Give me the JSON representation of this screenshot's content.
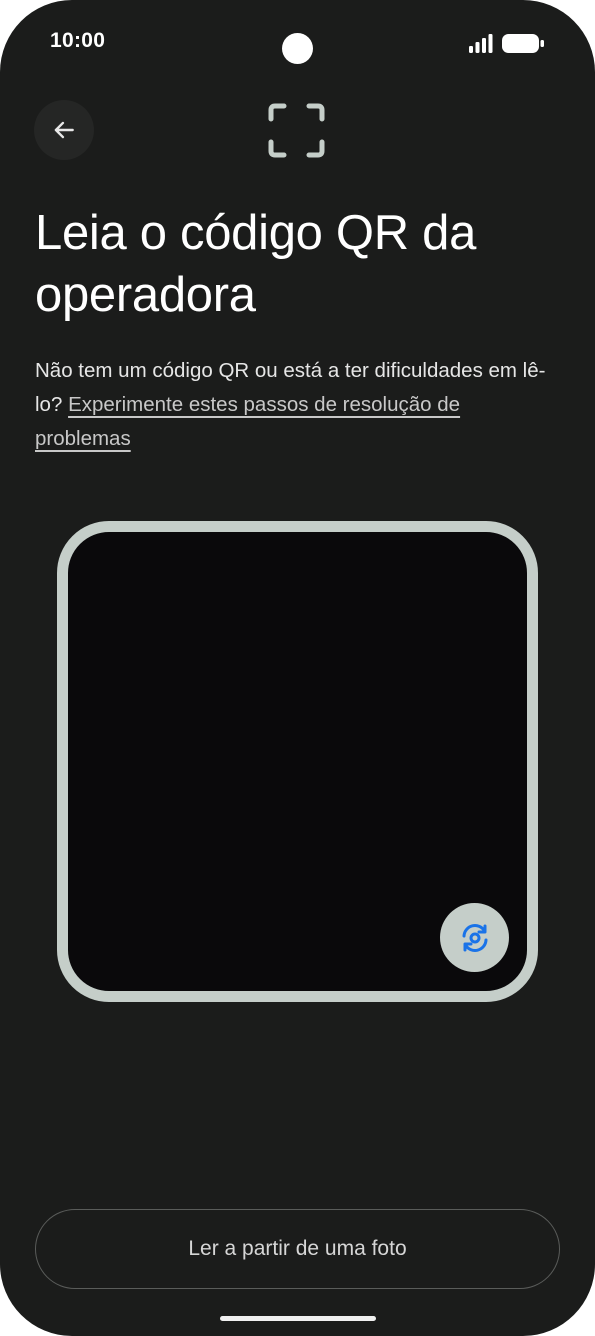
{
  "status_bar": {
    "time": "10:00",
    "icons": [
      "signal-icon",
      "battery-icon"
    ]
  },
  "header": {
    "back_icon": "arrow-back-icon",
    "scan_icon": "qr-scan-frame-icon"
  },
  "content": {
    "title": "Leia o código QR da operadora",
    "description_prefix": "Não tem um código QR ou está a ter dificuldades em lê-lo? ",
    "description_link": "Experimente estes passos de resolução de problemas"
  },
  "camera": {
    "flip_icon": "flip-camera-icon"
  },
  "footer": {
    "photo_button_label": "Ler a partir de uma foto"
  },
  "colors": {
    "background": "#1b1c1b",
    "frame": "#c5cec9",
    "accent_blue": "#1a73e8",
    "viewfinder": "#0a090b"
  }
}
